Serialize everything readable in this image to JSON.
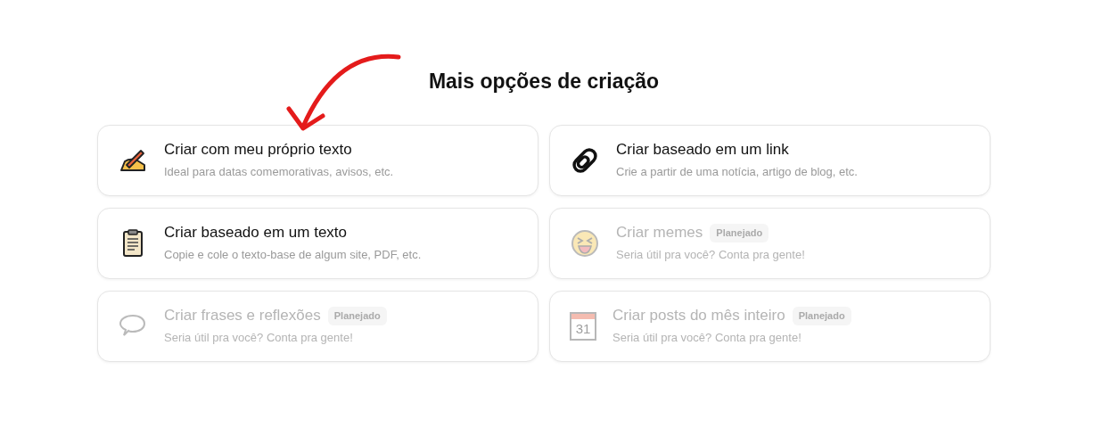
{
  "heading": "Mais opções de criação",
  "options": [
    {
      "kind": "writing",
      "title": "Criar com meu próprio texto",
      "subtitle": "Ideal para datas comemorativas, avisos, etc.",
      "disabled": false
    },
    {
      "kind": "link",
      "title": "Criar baseado em um link",
      "subtitle": "Crie a partir de uma notícia, artigo de blog, etc.",
      "disabled": false
    },
    {
      "kind": "clipboard",
      "title": "Criar baseado em um texto",
      "subtitle": "Copie e cole o texto-base de algum site, PDF, etc.",
      "disabled": false
    },
    {
      "kind": "laugh",
      "title": "Criar memes",
      "badge": "Planejado",
      "subtitle": "Seria útil pra você? Conta pra gente!",
      "disabled": true
    },
    {
      "kind": "speech",
      "title": "Criar frases e reflexões",
      "badge": "Planejado",
      "subtitle": "Seria útil pra você? Conta pra gente!",
      "disabled": true
    },
    {
      "kind": "calendar",
      "icon_text": "31",
      "title": "Criar posts do mês inteiro",
      "badge": "Planejado",
      "subtitle": "Seria útil pra você? Conta pra gente!",
      "disabled": true
    }
  ]
}
